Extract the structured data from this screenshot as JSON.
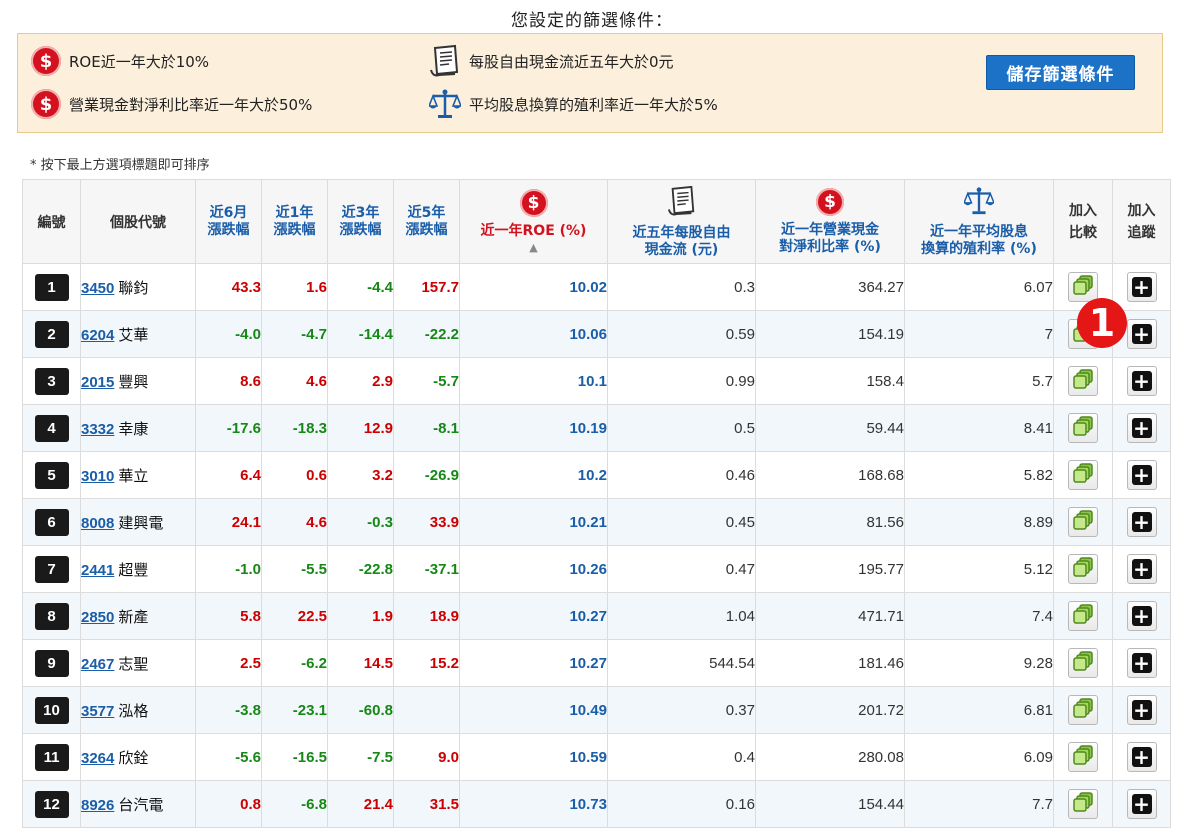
{
  "page_title": "您設定的篩選條件：",
  "criteria": [
    {
      "icon": "dollar-icon",
      "text": "ROE近一年大於10%"
    },
    {
      "icon": "document-icon",
      "text": "每股自由現金流近五年大於0元"
    },
    {
      "icon": "dollar-icon",
      "text": "營業現金對淨利比率近一年大於50%"
    },
    {
      "icon": "scale-icon",
      "text": "平均股息換算的殖利率近一年大於5%"
    }
  ],
  "save_button": "儲存篩選條件",
  "sort_hint": "* 按下最上方選項標題即可排序",
  "headers": {
    "idx": "編號",
    "stock": "個股代號",
    "m6": [
      "近6月",
      "漲跌幅"
    ],
    "y1": [
      "近1年",
      "漲跌幅"
    ],
    "y3": [
      "近3年",
      "漲跌幅"
    ],
    "y5": [
      "近5年",
      "漲跌幅"
    ],
    "roe": "近一年ROE (%)",
    "fcf": [
      "近五年每股自由",
      "現金流 (元)"
    ],
    "ocf": [
      "近一年營業現金",
      "對淨利比率 (%)"
    ],
    "yield": [
      "近一年平均股息",
      "換算的殖利率 (%)"
    ],
    "compare": [
      "加入",
      "比較"
    ],
    "track": [
      "加入",
      "追蹤"
    ]
  },
  "sort_arrow": "▲",
  "marker": "1",
  "colors": {
    "up": "#cc0000",
    "down": "#158815",
    "link": "#1a5da8",
    "accent": "#d4121f",
    "button": "#1b72c7"
  },
  "rows": [
    {
      "no": "1",
      "code": "3450",
      "name": "聯鈞",
      "m6": "43.3",
      "y1": "1.6",
      "y3": "-4.4",
      "y5": "157.7",
      "roe": "10.02",
      "fcf": "0.3",
      "ocf": "364.27",
      "yield": "6.07"
    },
    {
      "no": "2",
      "code": "6204",
      "name": "艾華",
      "m6": "-4.0",
      "y1": "-4.7",
      "y3": "-14.4",
      "y5": "-22.2",
      "roe": "10.06",
      "fcf": "0.59",
      "ocf": "154.19",
      "yield": "7"
    },
    {
      "no": "3",
      "code": "2015",
      "name": "豐興",
      "m6": "8.6",
      "y1": "4.6",
      "y3": "2.9",
      "y5": "-5.7",
      "roe": "10.1",
      "fcf": "0.99",
      "ocf": "158.4",
      "yield": "5.7"
    },
    {
      "no": "4",
      "code": "3332",
      "name": "幸康",
      "m6": "-17.6",
      "y1": "-18.3",
      "y3": "12.9",
      "y5": "-8.1",
      "roe": "10.19",
      "fcf": "0.5",
      "ocf": "59.44",
      "yield": "8.41"
    },
    {
      "no": "5",
      "code": "3010",
      "name": "華立",
      "m6": "6.4",
      "y1": "0.6",
      "y3": "3.2",
      "y5": "-26.9",
      "roe": "10.2",
      "fcf": "0.46",
      "ocf": "168.68",
      "yield": "5.82"
    },
    {
      "no": "6",
      "code": "8008",
      "name": "建興電",
      "m6": "24.1",
      "y1": "4.6",
      "y3": "-0.3",
      "y5": "33.9",
      "roe": "10.21",
      "fcf": "0.45",
      "ocf": "81.56",
      "yield": "8.89"
    },
    {
      "no": "7",
      "code": "2441",
      "name": "超豐",
      "m6": "-1.0",
      "y1": "-5.5",
      "y3": "-22.8",
      "y5": "-37.1",
      "roe": "10.26",
      "fcf": "0.47",
      "ocf": "195.77",
      "yield": "5.12"
    },
    {
      "no": "8",
      "code": "2850",
      "name": "新產",
      "m6": "5.8",
      "y1": "22.5",
      "y3": "1.9",
      "y5": "18.9",
      "roe": "10.27",
      "fcf": "1.04",
      "ocf": "471.71",
      "yield": "7.4"
    },
    {
      "no": "9",
      "code": "2467",
      "name": "志聖",
      "m6": "2.5",
      "y1": "-6.2",
      "y3": "14.5",
      "y5": "15.2",
      "roe": "10.27",
      "fcf": "544.54",
      "ocf": "181.46",
      "yield": "9.28"
    },
    {
      "no": "10",
      "code": "3577",
      "name": "泓格",
      "m6": "-3.8",
      "y1": "-23.1",
      "y3": "-60.8",
      "y5": "",
      "roe": "10.49",
      "fcf": "0.37",
      "ocf": "201.72",
      "yield": "6.81"
    },
    {
      "no": "11",
      "code": "3264",
      "name": "欣銓",
      "m6": "-5.6",
      "y1": "-16.5",
      "y3": "-7.5",
      "y5": "9.0",
      "roe": "10.59",
      "fcf": "0.4",
      "ocf": "280.08",
      "yield": "6.09"
    },
    {
      "no": "12",
      "code": "8926",
      "name": "台汽電",
      "m6": "0.8",
      "y1": "-6.8",
      "y3": "21.4",
      "y5": "31.5",
      "roe": "10.73",
      "fcf": "0.16",
      "ocf": "154.44",
      "yield": "7.7"
    }
  ]
}
